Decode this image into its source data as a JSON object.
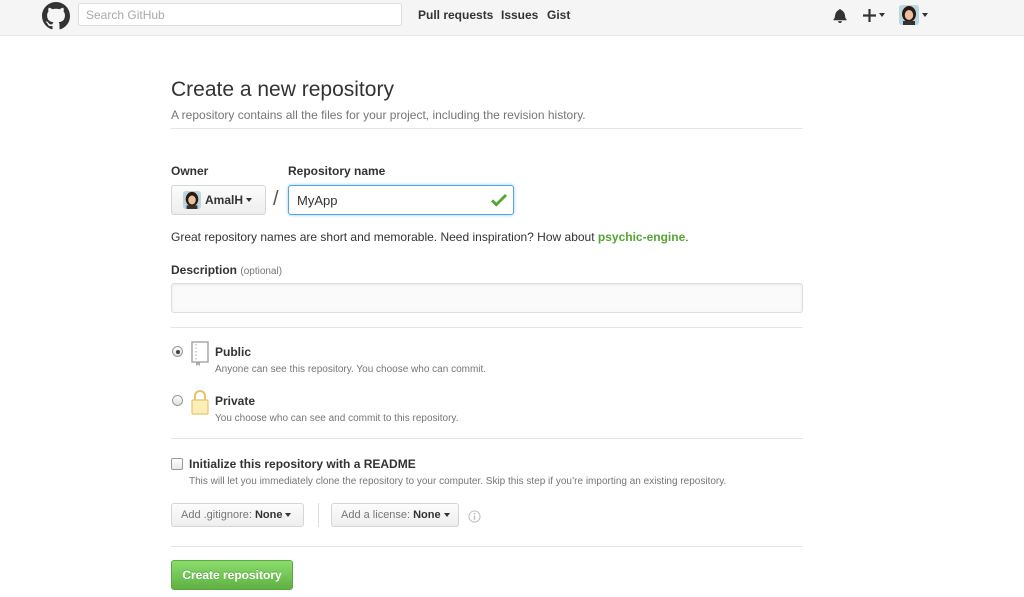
{
  "header": {
    "search_placeholder": "Search GitHub",
    "nav": [
      "Pull requests",
      "Issues",
      "Gist"
    ],
    "icons": [
      "github-logo-icon",
      "bell-icon",
      "plus-icon",
      "avatar"
    ]
  },
  "page": {
    "title": "Create a new repository",
    "subtitle": "A repository contains all the files for your project, including the revision history."
  },
  "form": {
    "owner_label": "Owner",
    "owner_value": "AmalH",
    "repo_label": "Repository name",
    "repo_value": "MyApp",
    "slash": "/",
    "hint_prefix": "Great repository names are short and memorable. Need inspiration? How about ",
    "hint_suggestion": "psychic-engine",
    "hint_suffix": ".",
    "description_label": "Description",
    "description_optional": "(optional)",
    "description_value": ""
  },
  "visibility": {
    "selected": "public",
    "public_title": "Public",
    "public_desc": "Anyone can see this repository. You choose who can commit.",
    "private_title": "Private",
    "private_desc": "You choose who can see and commit to this repository."
  },
  "init": {
    "readme_label": "Initialize this repository with a README",
    "readme_desc": "This will let you immediately clone the repository to your computer. Skip this step if you’re importing an existing repository.",
    "readme_checked": false,
    "gitignore_prefix": "Add .gitignore:",
    "gitignore_value": "None",
    "license_prefix": "Add a license:",
    "license_value": "None"
  },
  "actions": {
    "create_label": "Create repository"
  },
  "colors": {
    "accent_green": "#55a532",
    "button_green": "#6cc644",
    "focus_blue": "#51a7e8"
  }
}
